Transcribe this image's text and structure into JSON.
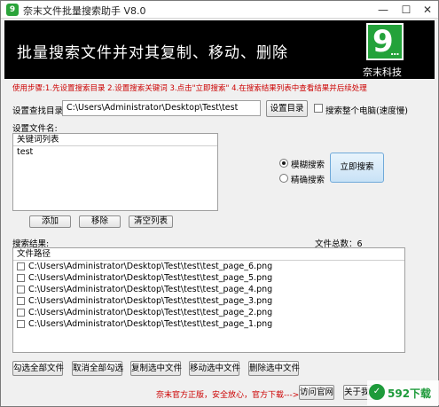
{
  "window": {
    "title": "奈末文件批量搜索助手 V8.0",
    "app_icon": "9"
  },
  "banner": {
    "title": "批量搜索文件并对其复制、移动、删除",
    "logo_number": "9",
    "logo_dots": "...",
    "logo_company": "奈末科技"
  },
  "usage": "使用步骤:1.先设置搜索目录 2.设置搜索关键词 3.点击\"立即搜索\" 4.在搜索结果列表中查看结果并后续处理",
  "search_dir": {
    "label": "设置查找目录:",
    "value": "C:\\Users\\Administrator\\Desktop\\Test\\test",
    "button": "设置目录",
    "whole_pc_label": "搜索整个电脑(速度慢)"
  },
  "filename": {
    "label": "设置文件名:",
    "list_header": "关键词列表",
    "keywords": [
      "test"
    ]
  },
  "keyword_buttons": {
    "add": "添加",
    "remove": "移除",
    "clear": "清空列表"
  },
  "mode": {
    "fuzzy": "模糊搜索",
    "exact": "精确搜索",
    "selected": "fuzzy"
  },
  "search_button": "立即搜索",
  "results": {
    "label": "搜索结果:",
    "count_label": "文件总数：6",
    "header": "文件路径",
    "files": [
      "C:\\Users\\Administrator\\Desktop\\Test\\test\\test_page_6.png",
      "C:\\Users\\Administrator\\Desktop\\Test\\test\\test_page_5.png",
      "C:\\Users\\Administrator\\Desktop\\Test\\test\\test_page_4.png",
      "C:\\Users\\Administrator\\Desktop\\Test\\test\\test_page_3.png",
      "C:\\Users\\Administrator\\Desktop\\Test\\test\\test_page_2.png",
      "C:\\Users\\Administrator\\Desktop\\Test\\test\\test_page_1.png"
    ]
  },
  "actions": {
    "select_all": "勾选全部文件",
    "deselect_all": "取消全部勾选",
    "copy": "复制选中文件",
    "move": "移动选中文件",
    "delete": "删除选中文件"
  },
  "footer": {
    "text": "奈末官方正版，安全放心，官方下载--->",
    "visit_button": "访问官网",
    "about_button": "关于我们"
  },
  "watermark": {
    "icon": "✓",
    "text": "592下载"
  }
}
